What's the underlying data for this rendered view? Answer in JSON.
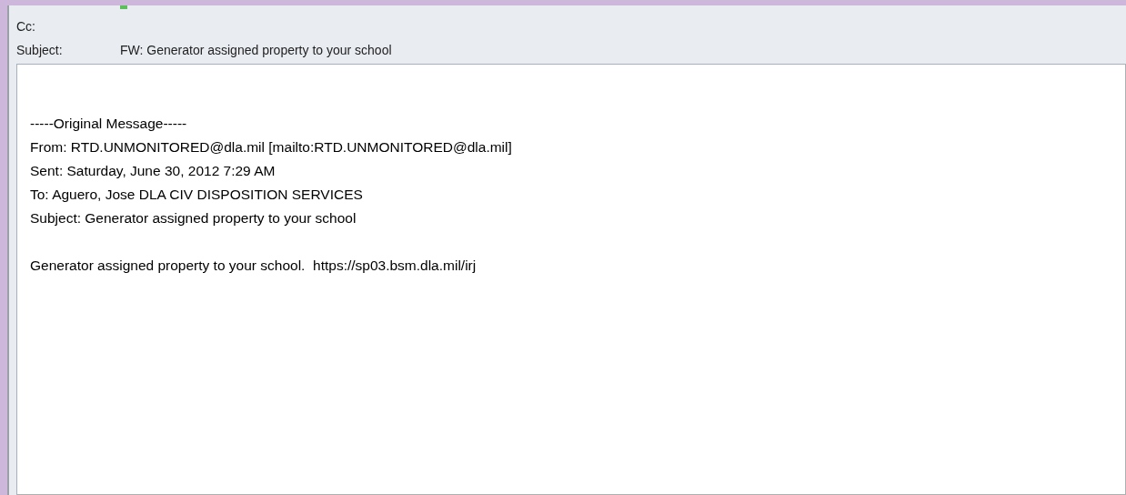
{
  "header": {
    "fields": [
      {
        "label": "Cc:"
      },
      {
        "label": "Subject:",
        "value": "FW: Generator assigned property to your school"
      }
    ]
  },
  "body": {
    "paragraphs": [
      [
        "-----Original Message-----",
        "From: RTD.UNMONITORED@dla.mil [mailto:RTD.UNMONITORED@dla.mil]",
        "Sent: Saturday, June 30, 2012 7:29 AM",
        "To: Aguero, Jose DLA CIV DISPOSITION SERVICES",
        "Subject: Generator assigned property to your school"
      ],
      [
        "Generator assigned property to your school.  https://sp03.bsm.dla.mil/irj"
      ]
    ]
  }
}
